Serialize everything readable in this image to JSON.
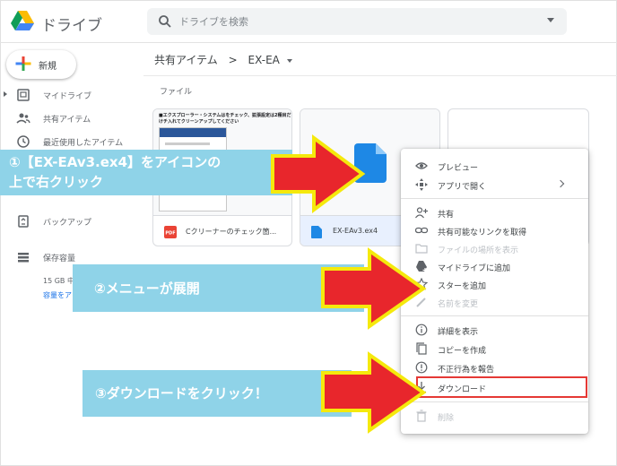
{
  "header": {
    "app_title": "ドライブ",
    "search_placeholder": "ドライブを検索"
  },
  "sidebar": {
    "new_label": "新規",
    "items": [
      {
        "label": "マイドライブ",
        "icon": "my-drive-icon"
      },
      {
        "label": "共有アイテム",
        "icon": "shared-icon"
      },
      {
        "label": "最近使用したアイテム",
        "icon": "recent-icon"
      },
      {
        "label": "バックアップ",
        "icon": "backup-icon"
      },
      {
        "label": "保存容量",
        "icon": "storage-icon"
      }
    ],
    "storage_text": "15 GB 中",
    "storage_link": "容量をア"
  },
  "main": {
    "breadcrumb_parent": "共有アイテム",
    "breadcrumb_sep": ">",
    "breadcrumb_current": "EX-EA",
    "section_label": "ファイル",
    "files": [
      {
        "name": "Cクリーナーのチェック箇...",
        "type_badge": "PDF",
        "preview_text": "■エクスプローラー・システムはをチェック、拡張設定は2種目だけチ入れてクリーンアップしてください"
      },
      {
        "name": "EX-EAv3.ex4",
        "type_badge": ""
      }
    ]
  },
  "context_menu": {
    "items": [
      {
        "label": "プレビュー",
        "icon": "eye-icon",
        "disabled": false
      },
      {
        "label": "アプリで開く",
        "icon": "open-with-icon",
        "disabled": false,
        "submenu": true
      },
      {
        "label": "共有",
        "icon": "share-person-icon",
        "disabled": false
      },
      {
        "label": "共有可能なリンクを取得",
        "icon": "link-icon",
        "disabled": false
      },
      {
        "label": "ファイルの場所を表示",
        "icon": "folder-icon",
        "disabled": true
      },
      {
        "label": "マイドライブに追加",
        "icon": "add-to-drive-icon",
        "disabled": false
      },
      {
        "label": "スターを追加",
        "icon": "star-icon",
        "disabled": false
      },
      {
        "label": "名前を変更",
        "icon": "pencil-icon",
        "disabled": true
      },
      {
        "label": "詳細を表示",
        "icon": "info-icon",
        "disabled": false
      },
      {
        "label": "コピーを作成",
        "icon": "copy-icon",
        "disabled": false
      },
      {
        "label": "不正行為を報告",
        "icon": "report-icon",
        "disabled": false
      },
      {
        "label": "ダウンロード",
        "icon": "download-icon",
        "disabled": false
      },
      {
        "label": "削除",
        "icon": "trash-icon",
        "disabled": true
      }
    ]
  },
  "annotations": {
    "step1_line1": "①【EX-EAv3.ex4】をアイコンの",
    "step1_line2": "上で右クリック",
    "step2": "②メニューが展開",
    "step3": "③ダウンロードをクリック！",
    "callout_color": "#8fd3e8",
    "arrow_fill": "#e8262c",
    "arrow_stroke": "#f5e90c"
  },
  "colors": {
    "accent": "#1a73e8",
    "highlight_border": "#e53935"
  }
}
